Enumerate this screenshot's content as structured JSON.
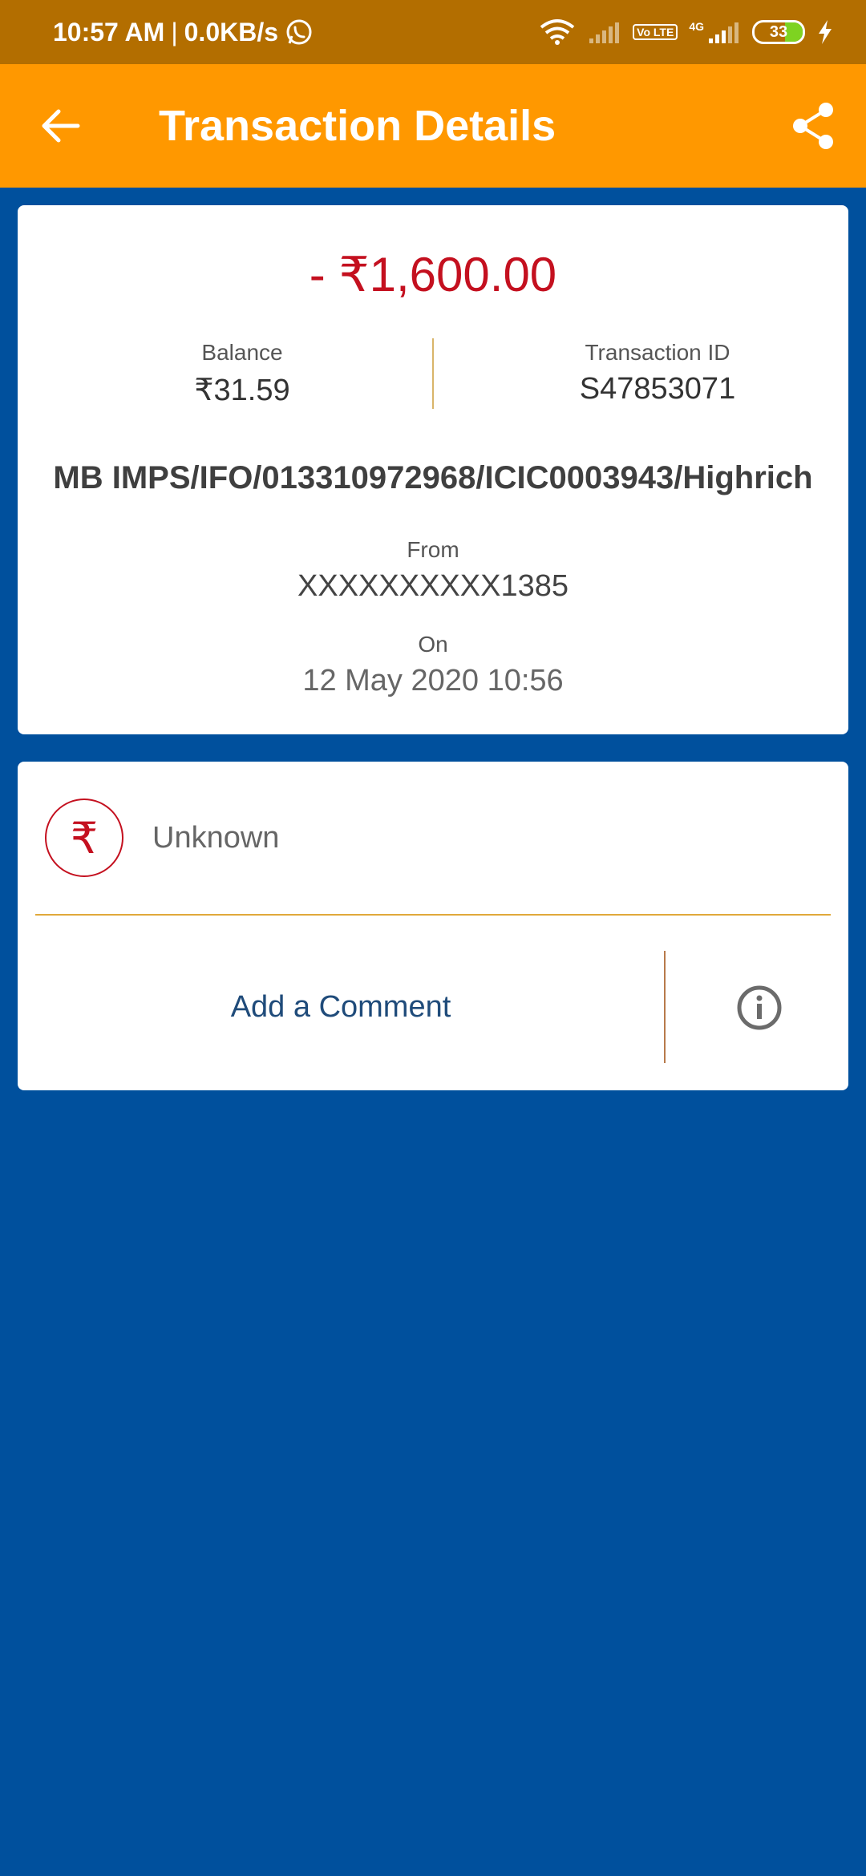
{
  "status_bar": {
    "time": "10:57 AM",
    "separator": "|",
    "net_speed": "0.0KB/s",
    "volte": "Vo LTE",
    "network_type": "4G",
    "battery": "33"
  },
  "app_bar": {
    "title": "Transaction Details"
  },
  "transaction": {
    "amount": "- ₹1,600.00",
    "balance_label": "Balance",
    "balance_value": "₹31.59",
    "txn_id_label": "Transaction ID",
    "txn_id_value": "S47853071",
    "narration": "MB IMPS/IFO/013310972968/ICIC0003943/Highrich",
    "from_label": "From",
    "from_value": "XXXXXXXXXX1385",
    "on_label": "On",
    "on_value": "12 May 2020 10:56"
  },
  "category": {
    "icon_symbol": "₹",
    "label": "Unknown"
  },
  "comment": {
    "label": "Add a Comment"
  },
  "colors": {
    "status_bar": "#b36e00",
    "app_bar": "#ff9800",
    "background": "#00509d",
    "debit": "#c4101f"
  }
}
